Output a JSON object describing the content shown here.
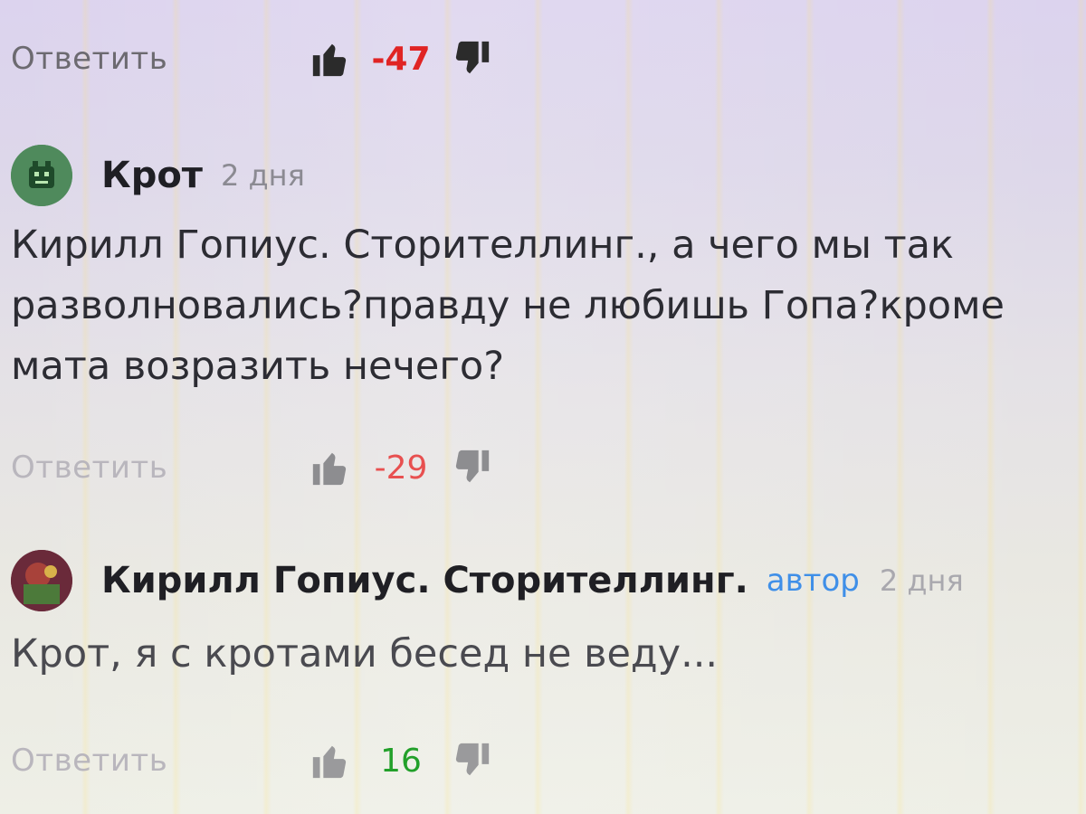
{
  "colors": {
    "negative": "#e02424",
    "positive": "#22a02a",
    "author_badge": "#3f8fe8",
    "avatar_krot": "#4f8a5c",
    "avatar_kirill": "#6a2a3a"
  },
  "top_actions": {
    "reply_label": "Ответить",
    "score": "-47"
  },
  "comments": [
    {
      "author": "Крот",
      "time": "2 дня",
      "text": "Кирилл Гопиус. Сторителлинг., а чего мы так разволновались?правду не любишь Гопа?кроме мата возразить нечего?",
      "reply_label": "Ответить",
      "score": "-29",
      "avatar_icon": "robot-avatar-icon"
    },
    {
      "author": "Кирилл Гопиус. Сторителлинг.",
      "badge": "автор",
      "time": "2 дня",
      "text": "Крот, я с кротами бесед не веду...",
      "reply_label": "Ответить",
      "score": "16",
      "avatar_icon": "user-avatar-icon"
    }
  ]
}
